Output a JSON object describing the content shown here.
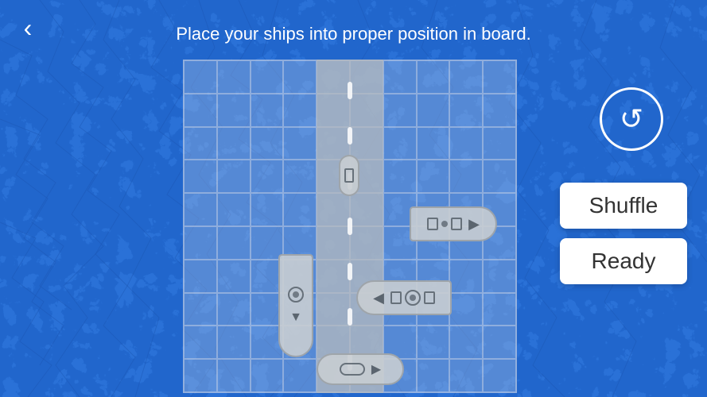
{
  "title": "Place your ships into proper position in board.",
  "back_button_label": "‹",
  "buttons": {
    "shuffle": "Shuffle",
    "ready": "Ready"
  },
  "rotate_icon": "↻",
  "ships": [
    {
      "id": "ship1",
      "orientation": "vertical"
    },
    {
      "id": "ship2",
      "orientation": "horizontal"
    },
    {
      "id": "ship3",
      "orientation": "vertical"
    },
    {
      "id": "ship4",
      "orientation": "horizontal"
    },
    {
      "id": "ship5",
      "orientation": "horizontal"
    }
  ],
  "board": {
    "cols": 10,
    "rows": 10
  }
}
